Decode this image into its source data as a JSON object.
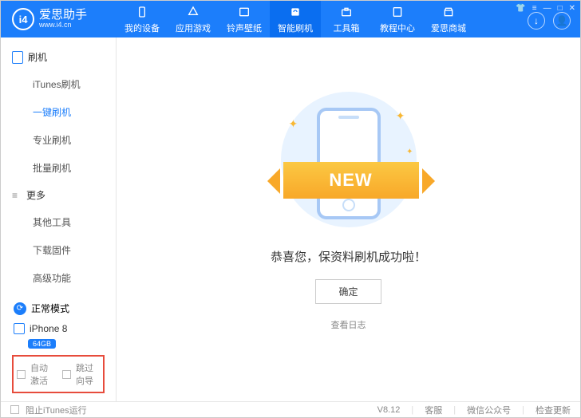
{
  "logo": {
    "icon_text": "i4",
    "title": "爱思助手",
    "url": "www.i4.cn"
  },
  "nav": [
    {
      "label": "我的设备"
    },
    {
      "label": "应用游戏"
    },
    {
      "label": "铃声壁纸"
    },
    {
      "label": "智能刷机",
      "active": true
    },
    {
      "label": "工具箱"
    },
    {
      "label": "教程中心"
    },
    {
      "label": "爱思商城"
    }
  ],
  "sidebar": {
    "group_flash": "刷机",
    "flash_items": [
      {
        "label": "iTunes刷机"
      },
      {
        "label": "一键刷机",
        "active": true
      },
      {
        "label": "专业刷机"
      },
      {
        "label": "批量刷机"
      }
    ],
    "group_more": "更多",
    "more_items": [
      {
        "label": "其他工具"
      },
      {
        "label": "下载固件"
      },
      {
        "label": "高级功能"
      }
    ],
    "mode": "正常模式",
    "device": "iPhone 8",
    "storage": "64GB",
    "auto_activate": "自动激活",
    "skip_guide": "跳过向导"
  },
  "main": {
    "banner_text": "NEW",
    "message": "恭喜您，保资料刷机成功啦！",
    "ok": "确定",
    "view_log": "查看日志"
  },
  "footer": {
    "prevent_itunes": "阻止iTunes运行",
    "version": "V8.12",
    "support": "客服",
    "wechat": "微信公众号",
    "check_update": "检查更新"
  }
}
